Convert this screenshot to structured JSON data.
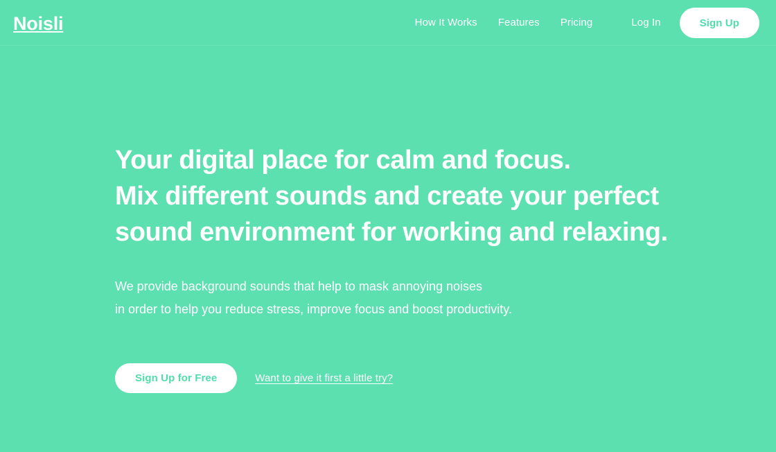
{
  "theme": {
    "background": "#5ce0b0",
    "accent_green": "#51ddab",
    "text_on_green": "#ffffff",
    "button_surface": "#ffffff"
  },
  "header": {
    "logo": "Noisli",
    "nav_items": [
      {
        "label": "How It Works",
        "name": "nav-how-it-works"
      },
      {
        "label": "Features",
        "name": "nav-features"
      },
      {
        "label": "Pricing",
        "name": "nav-pricing"
      }
    ],
    "login_label": "Log In",
    "signup_label": "Sign Up"
  },
  "hero": {
    "title_lines": [
      "Your digital place for calm and focus.",
      "Mix different sounds and create your perfect",
      "sound environment for working and relaxing."
    ],
    "subtitle_lines": [
      "We provide background sounds that help to mask annoying noises",
      "in order to help you reduce stress, improve focus and boost productivity."
    ],
    "cta_primary_label": "Sign Up for Free",
    "cta_secondary_label": "Want to give it first a little try?"
  }
}
